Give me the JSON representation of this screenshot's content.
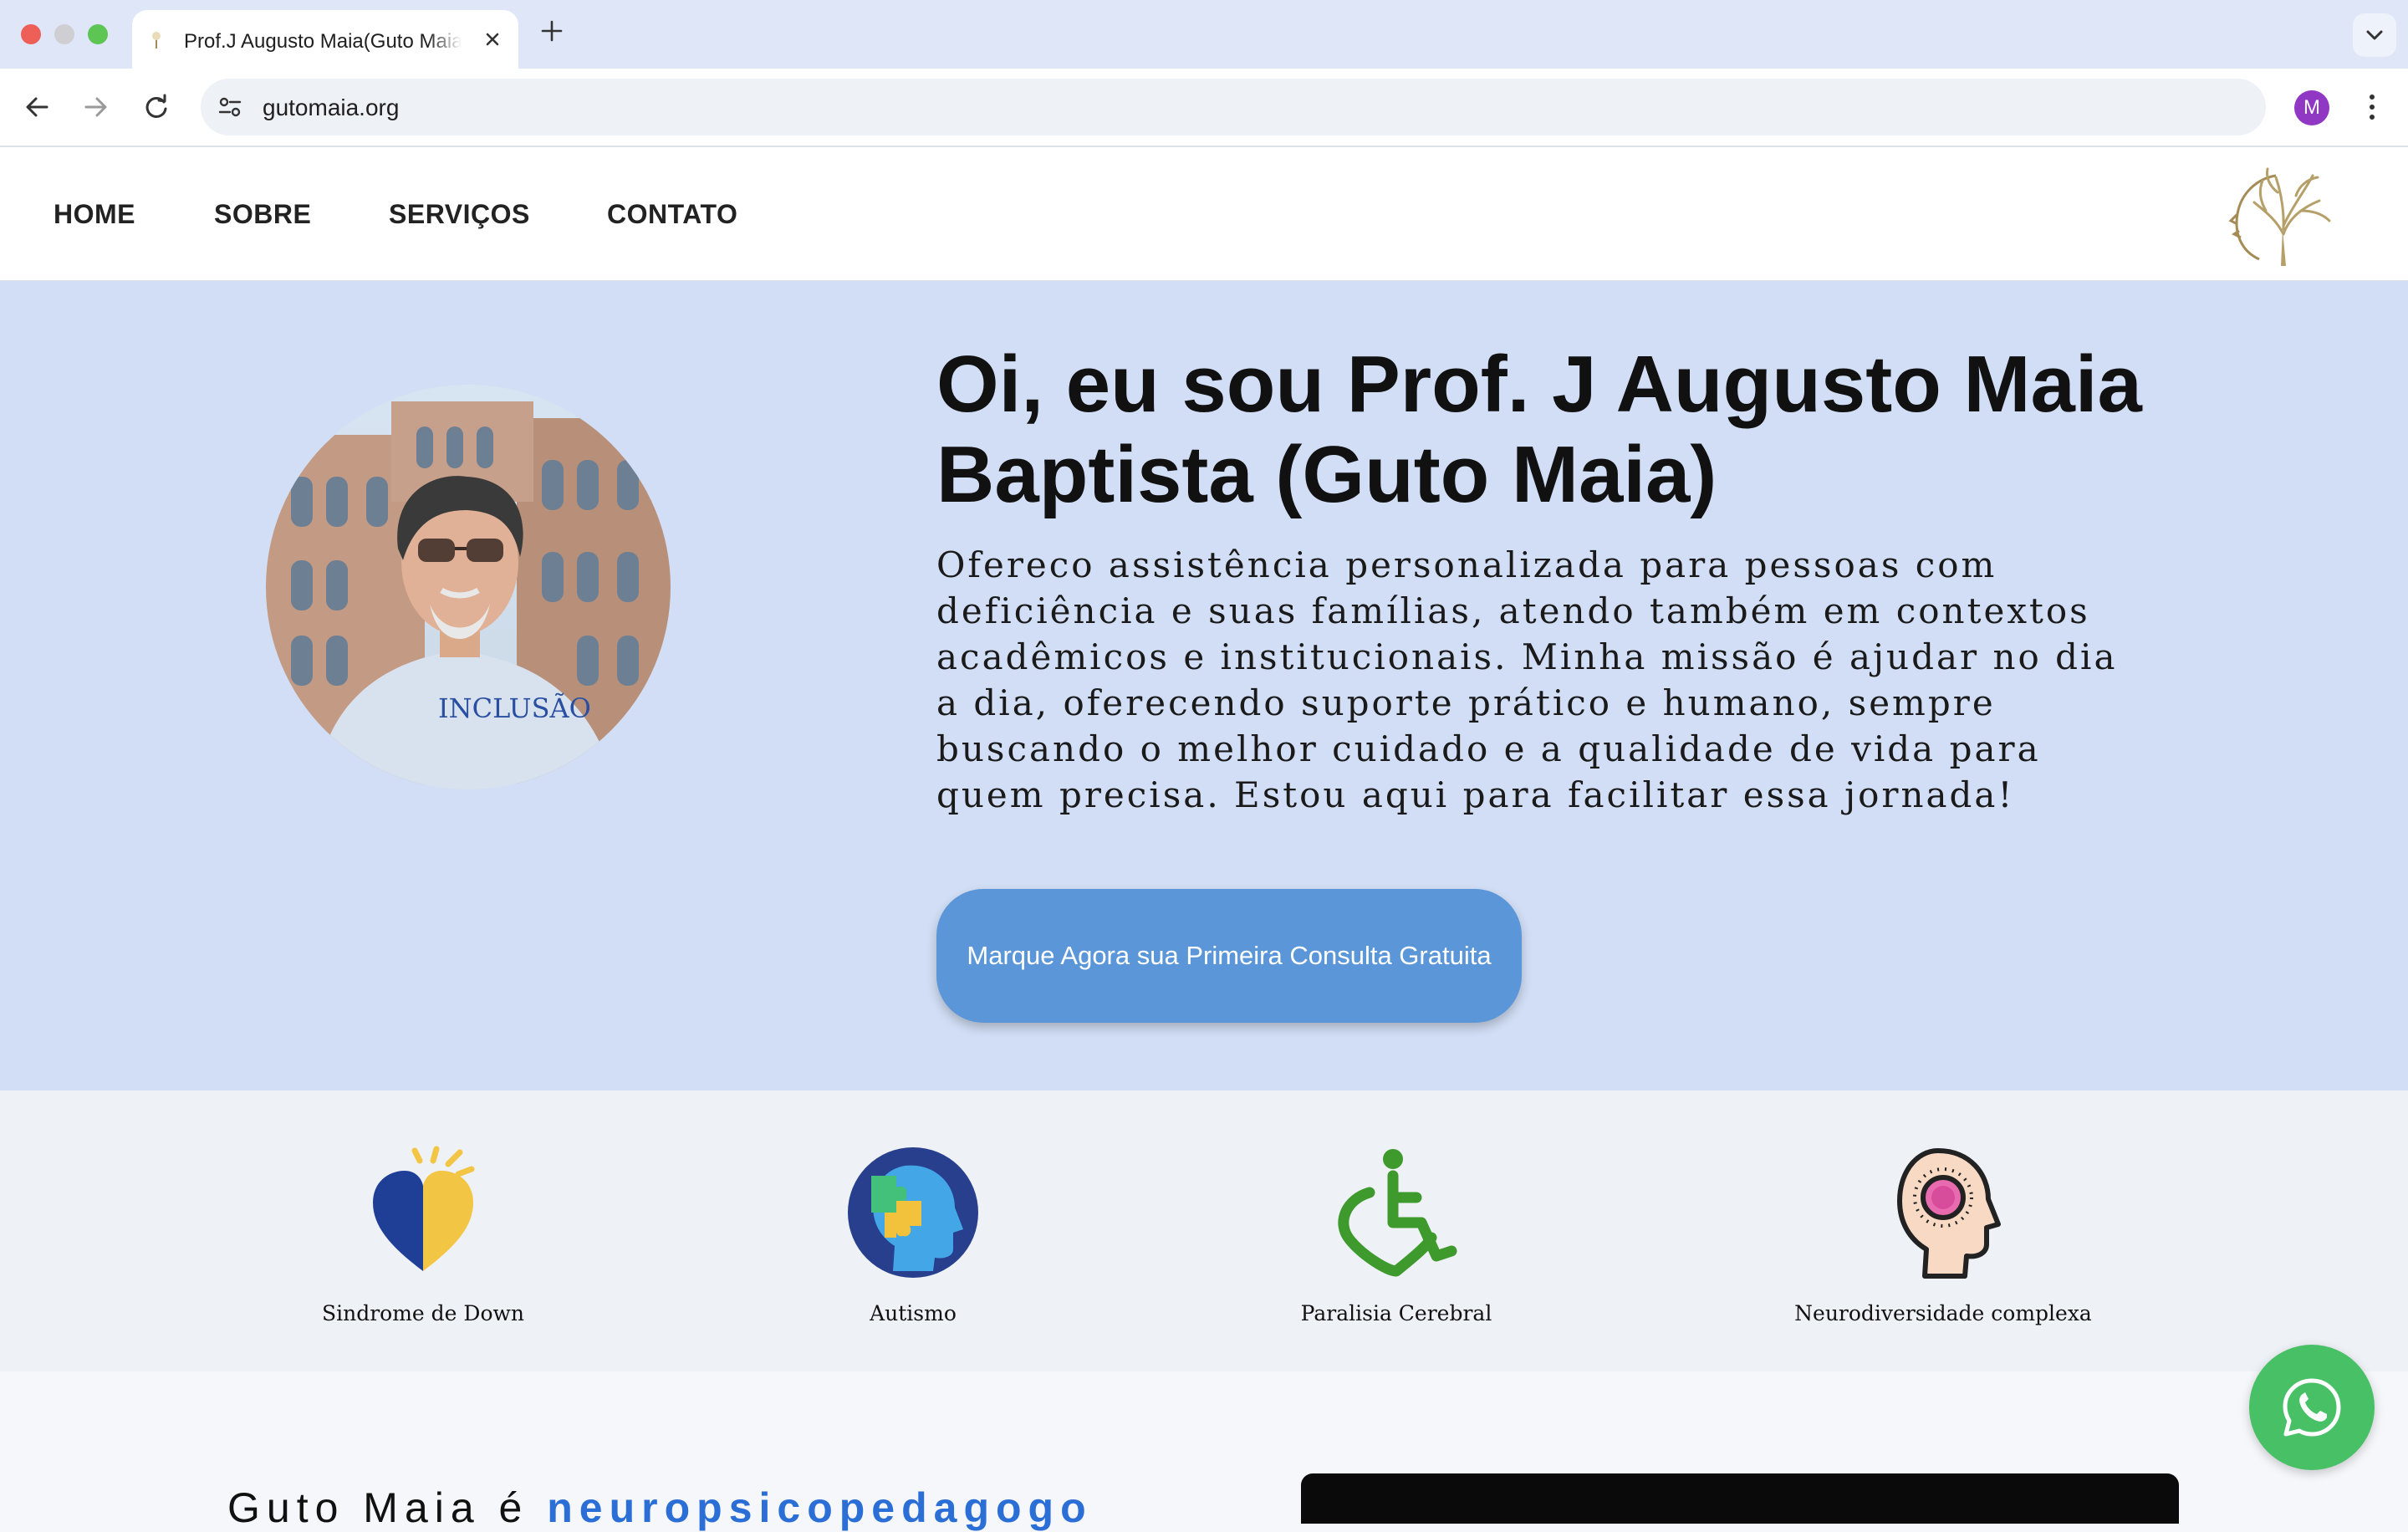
{
  "browser": {
    "tab_title": "Prof.J Augusto Maia(Guto Maia)",
    "url": "gutomaia.org",
    "profile_initial": "M"
  },
  "nav": {
    "items": [
      "HOME",
      "SOBRE",
      "SERVIÇOS",
      "CONTATO"
    ]
  },
  "hero": {
    "title": "Oi, eu sou Prof. J Augusto Maia Baptista (Guto Maia)",
    "text": "Ofereco assistência personalizada para pessoas com deficiência e suas famílias, atendo também em contextos acadêmicos e institucionais. Minha missão é ajudar no dia a dia, oferecendo suporte prático e humano, sempre buscando o melhor cuidado e a qualidade de vida para quem precisa. Estou aqui para facilitar essa jornada!",
    "cta_label": "Marque Agora sua Primeira Consulta Gratuita"
  },
  "conditions": [
    {
      "label": "Sindrome de Down",
      "icon": "heart-icon"
    },
    {
      "label": "Autismo",
      "icon": "puzzle-head-icon"
    },
    {
      "label": "Paralisia Cerebral",
      "icon": "wheelchair-icon"
    },
    {
      "label": "Neurodiversidade complexa",
      "icon": "brain-head-icon"
    }
  ],
  "about": {
    "lead": "Guto Maia é ",
    "highlight": "neuropsicopedagogo"
  },
  "colors": {
    "hero_bg": "#d1def5",
    "cta": "#5b97d8",
    "whatsapp": "#48c066",
    "highlight": "#2b6fd6"
  }
}
